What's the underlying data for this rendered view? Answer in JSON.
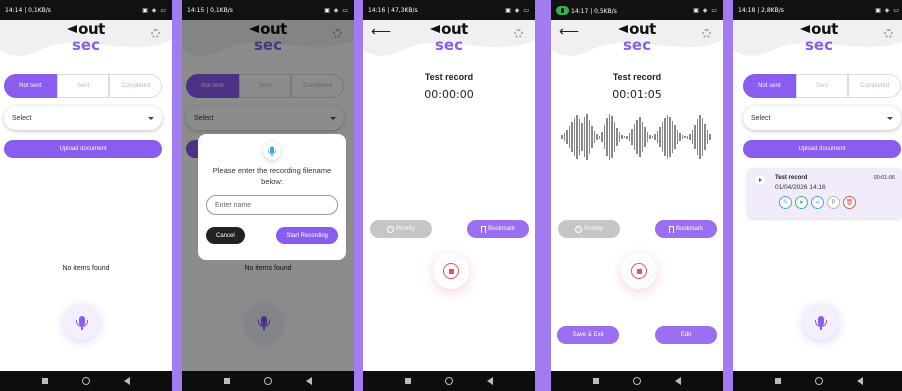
{
  "colors": {
    "accent": "#8a5cf0",
    "background": "#a07cf0",
    "danger": "#e05555"
  },
  "logo": {
    "top": "out",
    "bottom": "sec"
  },
  "tabs": [
    "Not sent",
    "Sent",
    "Completed"
  ],
  "select_placeholder": "Select",
  "upload_label": "Upload document",
  "empty_text": "No items found",
  "screens": [
    {
      "status_left": "14:14 | 0,1KB/s",
      "status_right": "▣ ◈ ▭"
    },
    {
      "status_left": "14:15 | 0,1KB/s",
      "status_right": "▣ ◈ ▭"
    },
    {
      "status_left": "14:16 | 47,3KB/s",
      "status_right": "▣ ◈ ▭"
    },
    {
      "status_left": "14:17 | 0,5KB/s",
      "status_right": "▣ ◈ ▭"
    },
    {
      "status_left": "14:18 | 2,8KB/s",
      "status_right": "▣ ◈ ▭"
    }
  ],
  "dialog": {
    "prompt": "Please enter the recording filename below:",
    "input_placeholder": "Enter name",
    "cancel": "Cancel",
    "start": "Start Recording"
  },
  "record": {
    "title": "Test record",
    "time_start": "00:00:00",
    "time_running": "00:01:05",
    "priority": "Priority",
    "bookmark": "Bookmark",
    "save_exit": "Save & Exit",
    "edit": "Edit"
  },
  "card": {
    "title": "Test record",
    "date": "01/04/2026 14:16",
    "duration": "00:01:06",
    "p_label": "P"
  }
}
